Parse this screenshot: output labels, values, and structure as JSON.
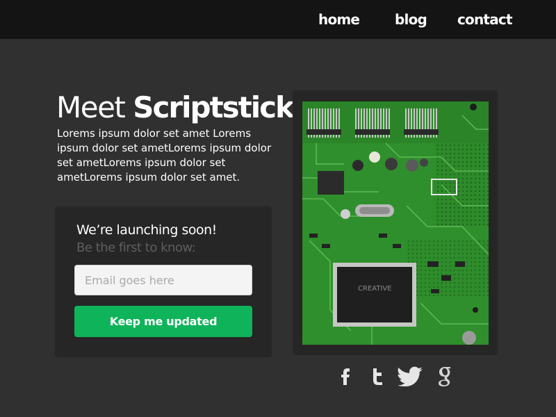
{
  "nav": {
    "items": [
      {
        "label": "home"
      },
      {
        "label": "blog"
      },
      {
        "label": "contact"
      }
    ]
  },
  "hero": {
    "title_prefix": "Meet",
    "title_brand": "Scriptstick",
    "description": "Lorems ipsum dolor set amet Lorems ipsum dolor set ametLorems ipsum dolor set ametLorems ipsum dolor set ametLorems ipsum dolor set amet."
  },
  "signup": {
    "heading": "We’re launching soon!",
    "subheading": "Be the first to know:",
    "email_placeholder": "Email goes here",
    "email_value": "",
    "button_label": "Keep me updated"
  },
  "photo": {
    "alt": "Circuit board",
    "chip_text": "CREATIVE"
  },
  "social": {
    "icons": [
      "facebook-icon",
      "tumblr-icon",
      "twitter-icon",
      "google-plus-icon"
    ]
  },
  "colors": {
    "background": "#303030",
    "header": "#141414",
    "card": "#262626",
    "accent": "#0fb35a",
    "muted_text": "#5e5e5e"
  }
}
